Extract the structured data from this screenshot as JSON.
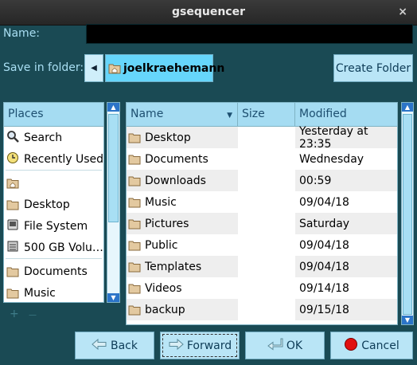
{
  "window": {
    "title": "gsequencer",
    "close_glyph": "×"
  },
  "name_label": "Name:",
  "name_value": "",
  "folder_label": "Save in folder:",
  "path": {
    "back_icon": "left-arrow-icon",
    "current": "joelkraehemann"
  },
  "create_folder": "Create Folder",
  "places": {
    "header": "Places",
    "items": [
      {
        "label": "Search",
        "icon": "search-icon"
      },
      {
        "label": "Recently Used",
        "icon": "clock-icon"
      },
      {
        "label": "",
        "icon": "home-folder-icon"
      },
      {
        "label": "Desktop",
        "icon": "folder-icon"
      },
      {
        "label": "File System",
        "icon": "harddisk-icon"
      },
      {
        "label": "500 GB Volu…",
        "icon": "drive-icon"
      },
      {
        "label": "Documents",
        "icon": "folder-icon"
      },
      {
        "label": "Music",
        "icon": "folder-icon"
      }
    ],
    "add_glyph": "+",
    "remove_glyph": "—"
  },
  "files": {
    "columns": {
      "name": "Name",
      "size": "Size",
      "modified": "Modified"
    },
    "rows": [
      {
        "name": "Desktop",
        "size": "",
        "modified": "Yesterday at 23:35"
      },
      {
        "name": "Documents",
        "size": "",
        "modified": "Wednesday"
      },
      {
        "name": "Downloads",
        "size": "",
        "modified": "00:59"
      },
      {
        "name": "Music",
        "size": "",
        "modified": "09/04/18"
      },
      {
        "name": "Pictures",
        "size": "",
        "modified": "Saturday"
      },
      {
        "name": "Public",
        "size": "",
        "modified": "09/04/18"
      },
      {
        "name": "Templates",
        "size": "",
        "modified": "09/04/18"
      },
      {
        "name": "Videos",
        "size": "",
        "modified": "09/14/18"
      },
      {
        "name": "backup",
        "size": "",
        "modified": "09/15/18"
      }
    ]
  },
  "buttons": {
    "back": "Back",
    "forward": "Forward",
    "ok": "OK",
    "cancel": "Cancel"
  },
  "colors": {
    "background": "#1a4a54",
    "accent": "#66d6fb",
    "scroll_arrow": "#2b74c8",
    "cancel_red": "#e01010"
  }
}
